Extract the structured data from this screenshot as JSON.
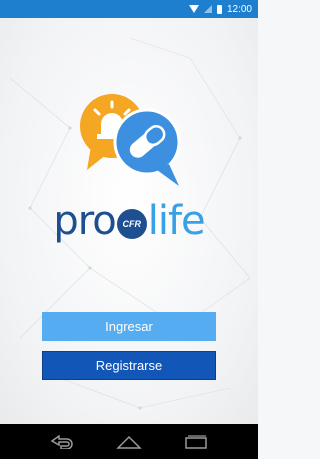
{
  "status_bar": {
    "time": "12:00",
    "icons": [
      "wifi-icon",
      "signal-icon",
      "battery-icon"
    ]
  },
  "brand": {
    "pro": "pro",
    "cfr": "CFR",
    "life": "life",
    "logo_icons": [
      "alarm-light-icon",
      "pill-icon"
    ]
  },
  "buttons": {
    "login_label": "Ingresar",
    "register_label": "Registrarse"
  },
  "nav_bar": {
    "icons": [
      "back-icon",
      "home-icon",
      "recent-apps-icon"
    ]
  },
  "colors": {
    "status_bar": "#1f7fcf",
    "login_button": "#55acf0",
    "register_button": "#1256b8",
    "brand_dark": "#1d4f91",
    "brand_light": "#3aa0e6",
    "bubble_orange": "#f5a623",
    "bubble_blue": "#3d8fe0"
  }
}
